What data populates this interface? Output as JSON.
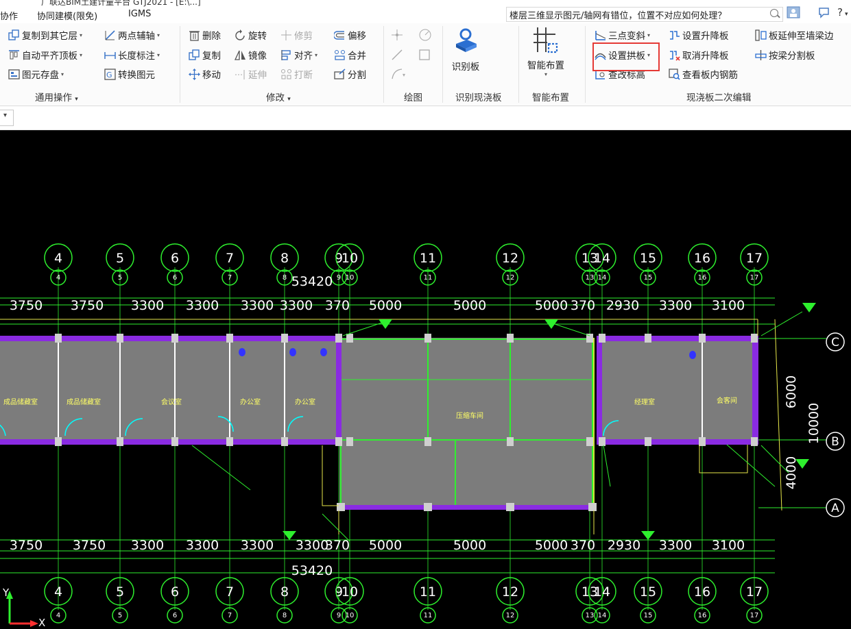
{
  "window": {
    "title_fragment": "广联达BIM土建计量平台 GTJ2021 - [E:\\...]"
  },
  "menu": {
    "items": [
      "协作",
      "协同建模(限免)",
      "IGMS"
    ]
  },
  "help": {
    "question": "楼层三维显示图元/轴网有错位，位置不对应如何处理？"
  },
  "ribbon": {
    "common": {
      "copy_to_floor": "复制到其它层",
      "auto_align": "自动平齐顶板",
      "save_element": "图元存盘",
      "two_point_axis": "两点辅轴",
      "length_dim": "长度标注",
      "convert_element": "转换图元",
      "label": "通用操作"
    },
    "modify": {
      "delete": "删除",
      "rotate": "旋转",
      "trim": "修剪",
      "offset": "偏移",
      "copy": "复制",
      "mirror": "镜像",
      "align": "对齐",
      "merge": "合并",
      "move": "移动",
      "extend": "延伸",
      "break": "打断",
      "split": "分割",
      "label": "修改"
    },
    "draw": {
      "label": "绘图"
    },
    "identify": {
      "button": "识别板",
      "label": "识别现浇板"
    },
    "smart": {
      "button": "智能布置",
      "label": "智能布置"
    },
    "slab_edit": {
      "three_point_slope": "三点变斜",
      "set_raise": "设置升降板",
      "extend_to_wall": "板延伸至墙梁边",
      "set_arch": "设置拱板",
      "cancel_raise": "取消升降板",
      "split_by_beam": "按梁分割板",
      "check_elevation": "查改标高",
      "view_rebar": "查看板内钢筋",
      "label": "现浇板二次编辑"
    }
  },
  "drawing": {
    "axes": [
      "4",
      "5",
      "6",
      "7",
      "8",
      "9",
      "10",
      "11",
      "12",
      "13",
      "14",
      "15",
      "16",
      "17"
    ],
    "row_axes": [
      "C",
      "B",
      "A"
    ],
    "top_dims": [
      "3750",
      "3750",
      "3300",
      "3300",
      "3300",
      "3300",
      "370",
      "5000",
      "5000",
      "5000",
      "370",
      "2930",
      "3300",
      "3100"
    ],
    "bottom_dims": [
      "3750",
      "3750",
      "3300",
      "3300",
      "3300",
      "3300",
      "370",
      "5000",
      "5000",
      "5000",
      "370",
      "2930",
      "3300",
      "3100"
    ],
    "total_dim": "53420",
    "side_dims": [
      "6000",
      "10000",
      "4000"
    ],
    "rooms": [
      "成品储藏室",
      "成品储藏室",
      "会议室",
      "办公室",
      "办公室",
      "压缩车间",
      "经理室",
      "会客间"
    ],
    "axis_labels": {
      "x": "X",
      "y": "Y"
    },
    "colors": {
      "background": "#000000",
      "axis": "#00ff00",
      "wall": "#8a2be2",
      "slab": "#7a7a7a"
    }
  }
}
